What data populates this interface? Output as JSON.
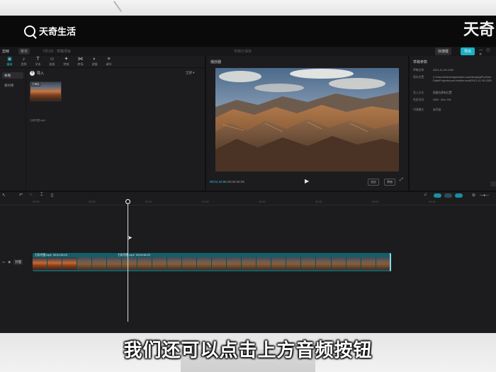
{
  "watermark": {
    "logo_text": "天奇生活",
    "corner_text": "天奇"
  },
  "app": {
    "name": "剪映",
    "menu_label": "菜单",
    "project_name": "7月1日 · 草稿项目",
    "center_label": "草稿已保存",
    "shortcut_label": "快捷键",
    "export_label": "导出",
    "window_controls": "— ▢ ✕"
  },
  "media_panel": {
    "tools": [
      {
        "icon": "media-icon",
        "glyph": "▣",
        "label": "媒体"
      },
      {
        "icon": "audio-icon",
        "glyph": "♪",
        "label": "音频"
      },
      {
        "icon": "text-icon",
        "glyph": "T",
        "label": "文本"
      },
      {
        "icon": "sticker-icon",
        "glyph": "☺",
        "label": "贴纸"
      },
      {
        "icon": "effects-icon",
        "glyph": "✦",
        "label": "特效"
      },
      {
        "icon": "transition-icon",
        "glyph": "⋈",
        "label": "转场"
      },
      {
        "icon": "filter-icon",
        "glyph": "◐",
        "label": "滤镜"
      },
      {
        "icon": "adjust-icon",
        "glyph": "≡",
        "label": "调节"
      }
    ],
    "sidebar": [
      {
        "label": "本地"
      },
      {
        "label": "素材库"
      }
    ],
    "import_label": "导入",
    "sort_label": "全部 ▾",
    "clip": {
      "added_badge": "已添加",
      "name": "七彩丹霞.mp4"
    }
  },
  "player": {
    "title": "播放器",
    "timecode_current": "00:01:42:06",
    "timecode_total": "00:06:25:05",
    "ratio_label": "适应",
    "ratio_label_2": "原始"
  },
  "details": {
    "title": "草稿参数",
    "rows": [
      {
        "key": "草稿名称",
        "value": "2021-11-29-1305"
      },
      {
        "key": "保存位置",
        "value": "C:/Users/Admin/AppData/Local/JianyingPro/User Data/Projects/com.lveditor.draft/2021-11-29-1305"
      },
      {
        "key": "导入方式",
        "value": "保留在原有位置"
      },
      {
        "key": "色彩空间",
        "value": "SDR - Rec.709"
      },
      {
        "key": "代理模式",
        "value": "未开启"
      }
    ]
  },
  "timeline": {
    "ruler_ticks": [
      "00:00",
      "00:30",
      "01:00",
      "01:30",
      "02:00",
      "02:30",
      "03:00",
      "03:30",
      "04:00",
      "04:30"
    ],
    "track_cover_label": "封面",
    "clip_labels": [
      {
        "name": "七彩丹霞.mp4",
        "duration": "00:01:28:15"
      },
      {
        "name": "七彩丹霞.mp4",
        "duration": "00:04:56:20"
      }
    ]
  },
  "subtitle": "我们还可以点击上方音频按钮"
}
